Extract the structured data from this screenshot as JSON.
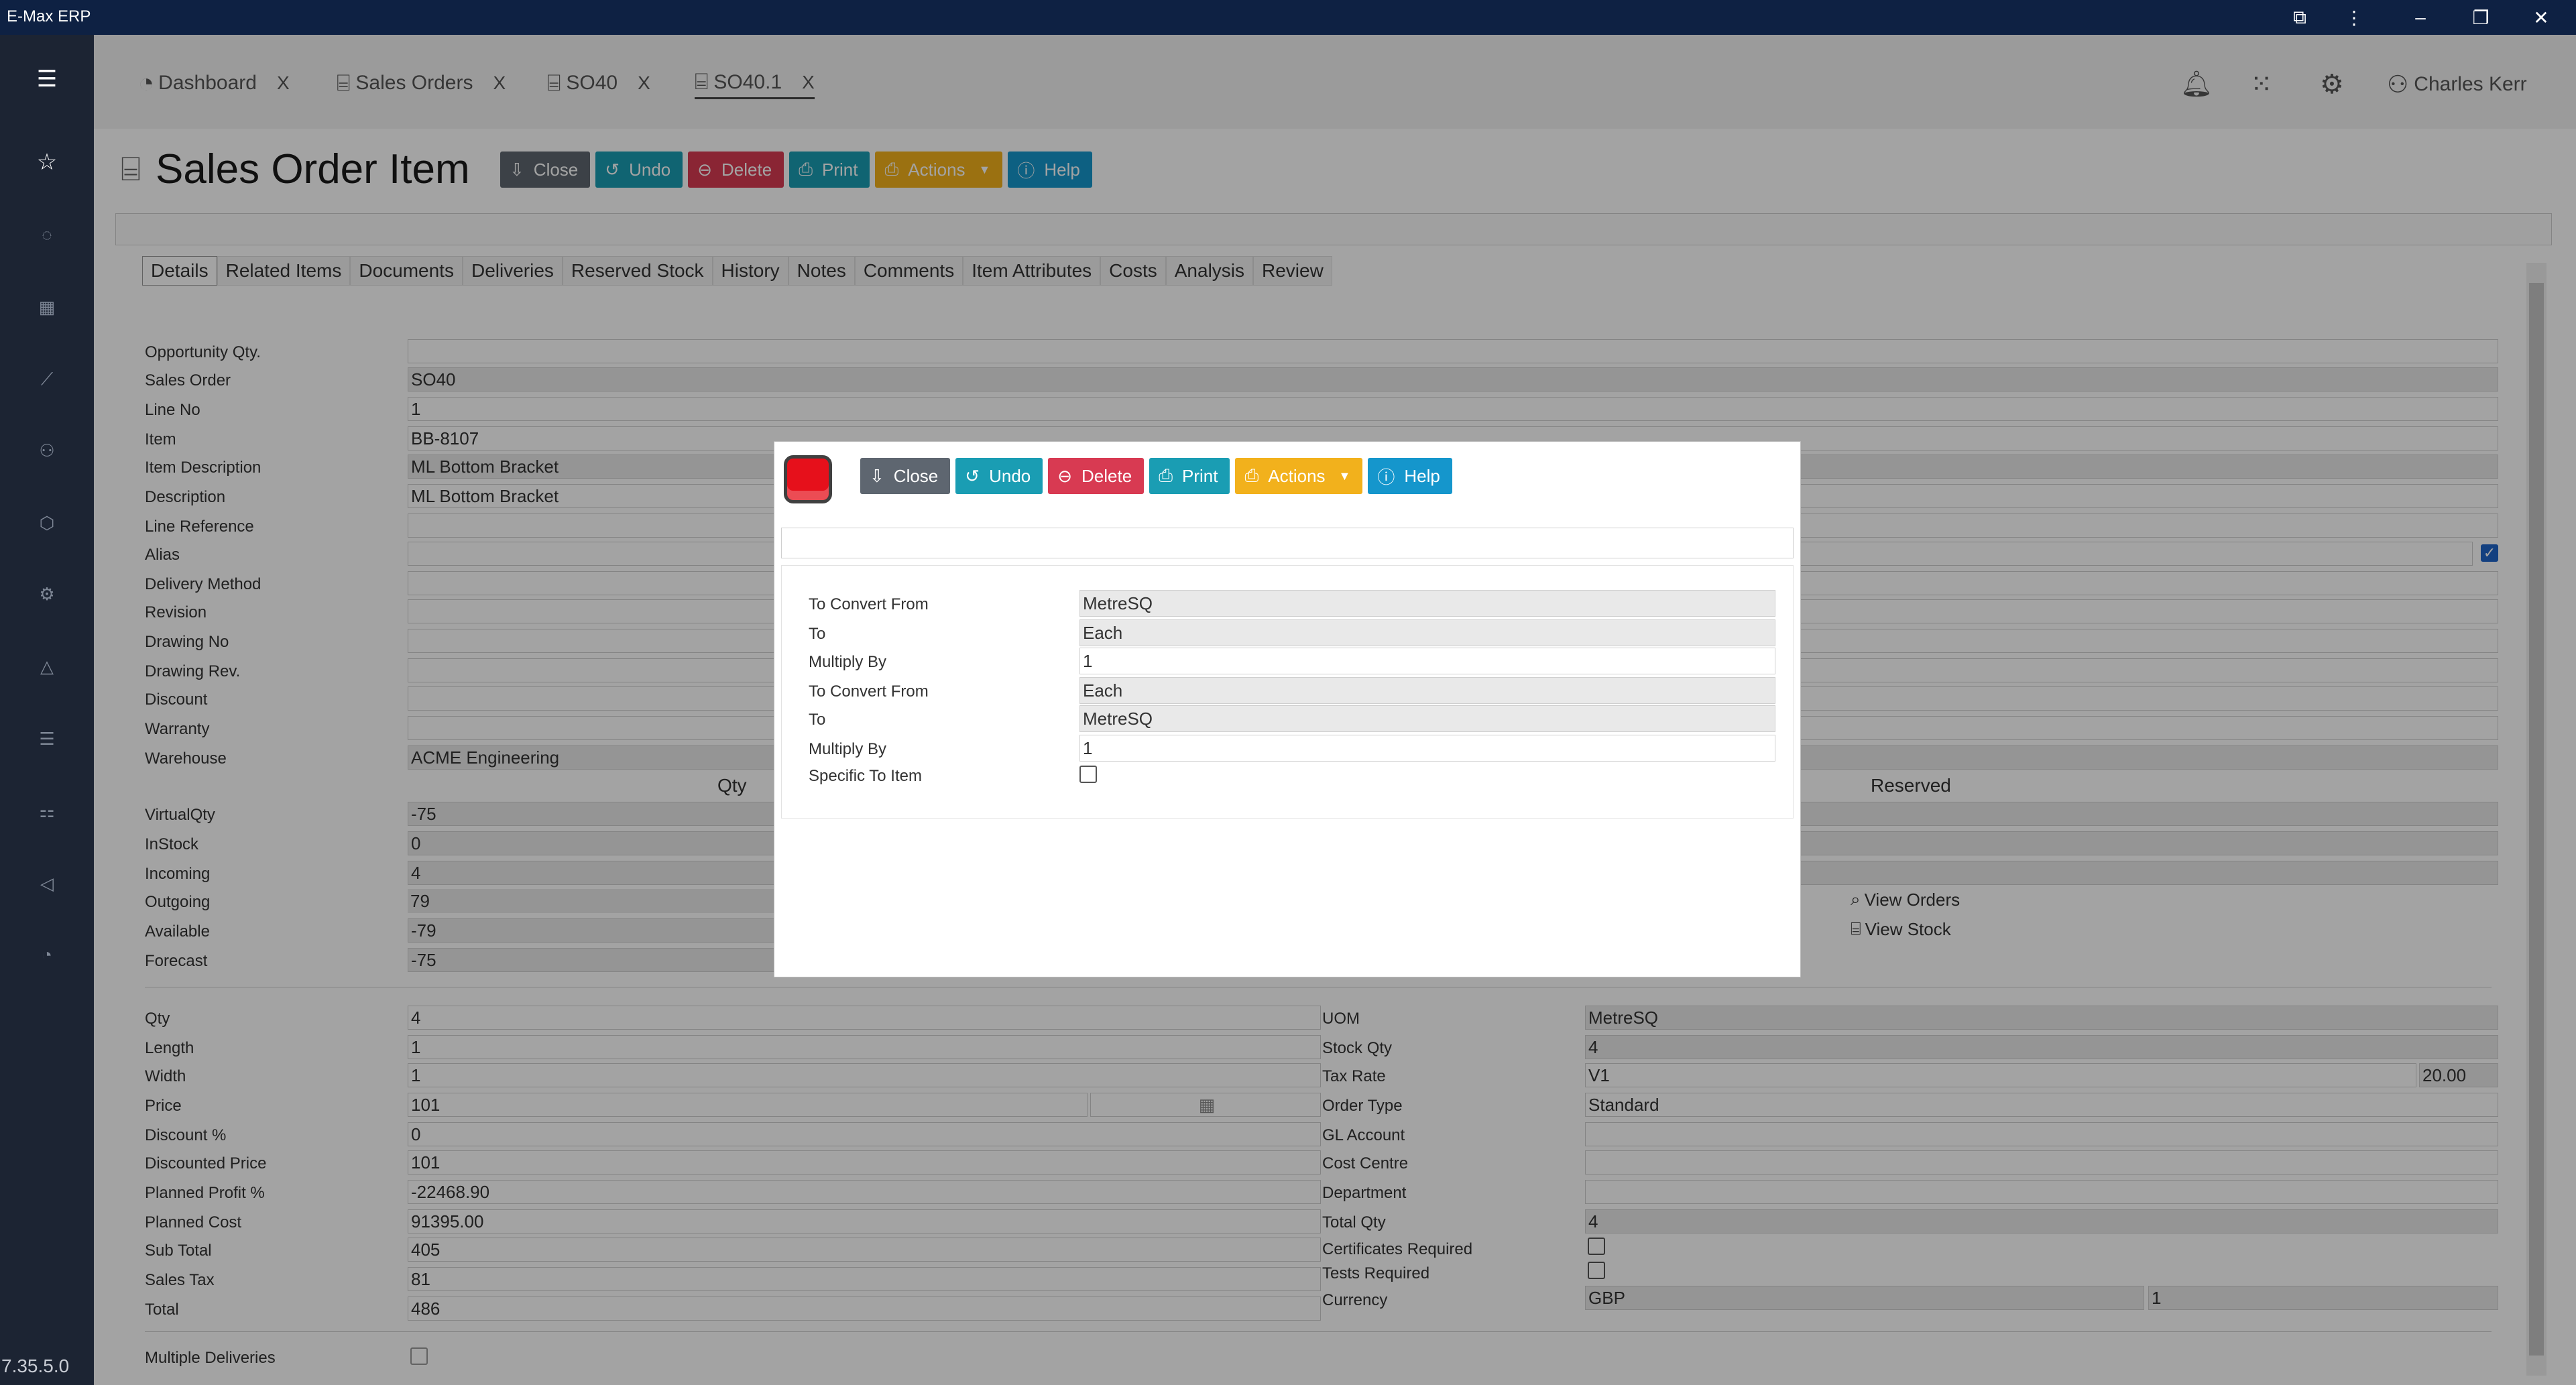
{
  "app": {
    "title": "E-Max ERP",
    "version": "7.35.5.0"
  },
  "tabs": [
    {
      "label": "Dashboard",
      "close": "X"
    },
    {
      "label": "Sales Orders",
      "close": "X"
    },
    {
      "label": "SO40",
      "close": "X"
    },
    {
      "label": "SO40.1",
      "close": "X"
    }
  ],
  "user": {
    "name": "Charles Kerr"
  },
  "page": {
    "title": "Sales Order Item"
  },
  "toolbar": {
    "close": "Close",
    "undo": "Undo",
    "delete": "Delete",
    "print": "Print",
    "actions": "Actions",
    "help": "Help"
  },
  "detail_tabs": [
    "Details",
    "Related Items",
    "Documents",
    "Deliveries",
    "Reserved Stock",
    "History",
    "Notes",
    "Comments",
    "Item Attributes",
    "Costs",
    "Analysis",
    "Review"
  ],
  "form": {
    "opportunity_qty": {
      "label": "Opportunity Qty.",
      "value": ""
    },
    "sales_order": {
      "label": "Sales Order",
      "value": "SO40"
    },
    "line_no": {
      "label": "Line No",
      "value": "1"
    },
    "item": {
      "label": "Item",
      "value": "BB-8107"
    },
    "item_description": {
      "label": "Item Description",
      "value": "ML Bottom Bracket"
    },
    "description": {
      "label": "Description",
      "value": "ML Bottom Bracket"
    },
    "line_reference": {
      "label": "Line Reference",
      "value": ""
    },
    "alias": {
      "label": "Alias",
      "value": ""
    },
    "delivery_method": {
      "label": "Delivery Method",
      "value": ""
    },
    "revision": {
      "label": "Revision",
      "value": ""
    },
    "drawing_no": {
      "label": "Drawing No",
      "value": ""
    },
    "drawing_rev": {
      "label": "Drawing Rev.",
      "value": ""
    },
    "discount": {
      "label": "Discount",
      "value": ""
    },
    "warranty": {
      "label": "Warranty",
      "value": ""
    },
    "warehouse": {
      "label": "Warehouse",
      "value": "ACME Engineering"
    }
  },
  "stock": {
    "qty_header": "Qty",
    "reserved_header": "Reserved",
    "rows": [
      {
        "label": "VirtualQty",
        "value": "-75"
      },
      {
        "label": "InStock",
        "value": "0"
      },
      {
        "label": "Incoming",
        "value": "4"
      },
      {
        "label": "Outgoing",
        "value": "79"
      },
      {
        "label": "Available",
        "value": "-79"
      },
      {
        "label": "Forecast",
        "value": "-75"
      }
    ],
    "view_orders": "View Orders",
    "view_stock": "View Stock"
  },
  "pricing_left": [
    {
      "label": "Qty",
      "value": "4"
    },
    {
      "label": "Length",
      "value": "1"
    },
    {
      "label": "Width",
      "value": "1"
    },
    {
      "label": "Price",
      "value": "101"
    },
    {
      "label": "Discount %",
      "value": "0"
    },
    {
      "label": "Discounted Price",
      "value": "101"
    },
    {
      "label": "Planned Profit %",
      "value": "-22468.90"
    },
    {
      "label": "Planned Cost",
      "value": "91395.00"
    },
    {
      "label": "Sub Total",
      "value": "405"
    },
    {
      "label": "Sales Tax",
      "value": "81"
    },
    {
      "label": "Total",
      "value": "486"
    }
  ],
  "pricing_right": {
    "uom": {
      "label": "UOM",
      "value": "MetreSQ"
    },
    "stock_qty": {
      "label": "Stock Qty",
      "value": "4"
    },
    "tax_rate": {
      "label": "Tax Rate",
      "value": "V1",
      "rate": "20.00"
    },
    "order_type": {
      "label": "Order Type",
      "value": "Standard"
    },
    "gl_account": {
      "label": "GL Account",
      "value": ""
    },
    "cost_centre": {
      "label": "Cost Centre",
      "value": ""
    },
    "department": {
      "label": "Department",
      "value": ""
    },
    "total_qty": {
      "label": "Total Qty",
      "value": "4"
    },
    "certificates_required": {
      "label": "Certificates Required",
      "checked": false
    },
    "tests_required": {
      "label": "Tests Required",
      "checked": false
    },
    "currency": {
      "label": "Currency",
      "value": "GBP",
      "rate": "1"
    }
  },
  "multiple_deliveries": {
    "label": "Multiple Deliveries",
    "checked": false
  },
  "modal": {
    "rows": [
      {
        "label": "To Convert From",
        "value": "MetreSQ",
        "readonly": true
      },
      {
        "label": "To",
        "value": "Each",
        "readonly": true
      },
      {
        "label": "Multiply By",
        "value": "1",
        "readonly": false
      },
      {
        "label": "To Convert From",
        "value": "Each",
        "readonly": true
      },
      {
        "label": "To",
        "value": "MetreSQ",
        "readonly": true
      },
      {
        "label": "Multiply By",
        "value": "1",
        "readonly": false
      }
    ],
    "specific_to_item": {
      "label": "Specific To Item",
      "checked": false
    }
  },
  "colors": {
    "titlebar": "#0e2143",
    "sidebar": "#1c2433",
    "close": "#5e6670",
    "undo": "#1a9db3",
    "delete": "#d83a52",
    "actions": "#f2b11c",
    "help": "#1596cc",
    "modal_icon": "#e6101b"
  }
}
